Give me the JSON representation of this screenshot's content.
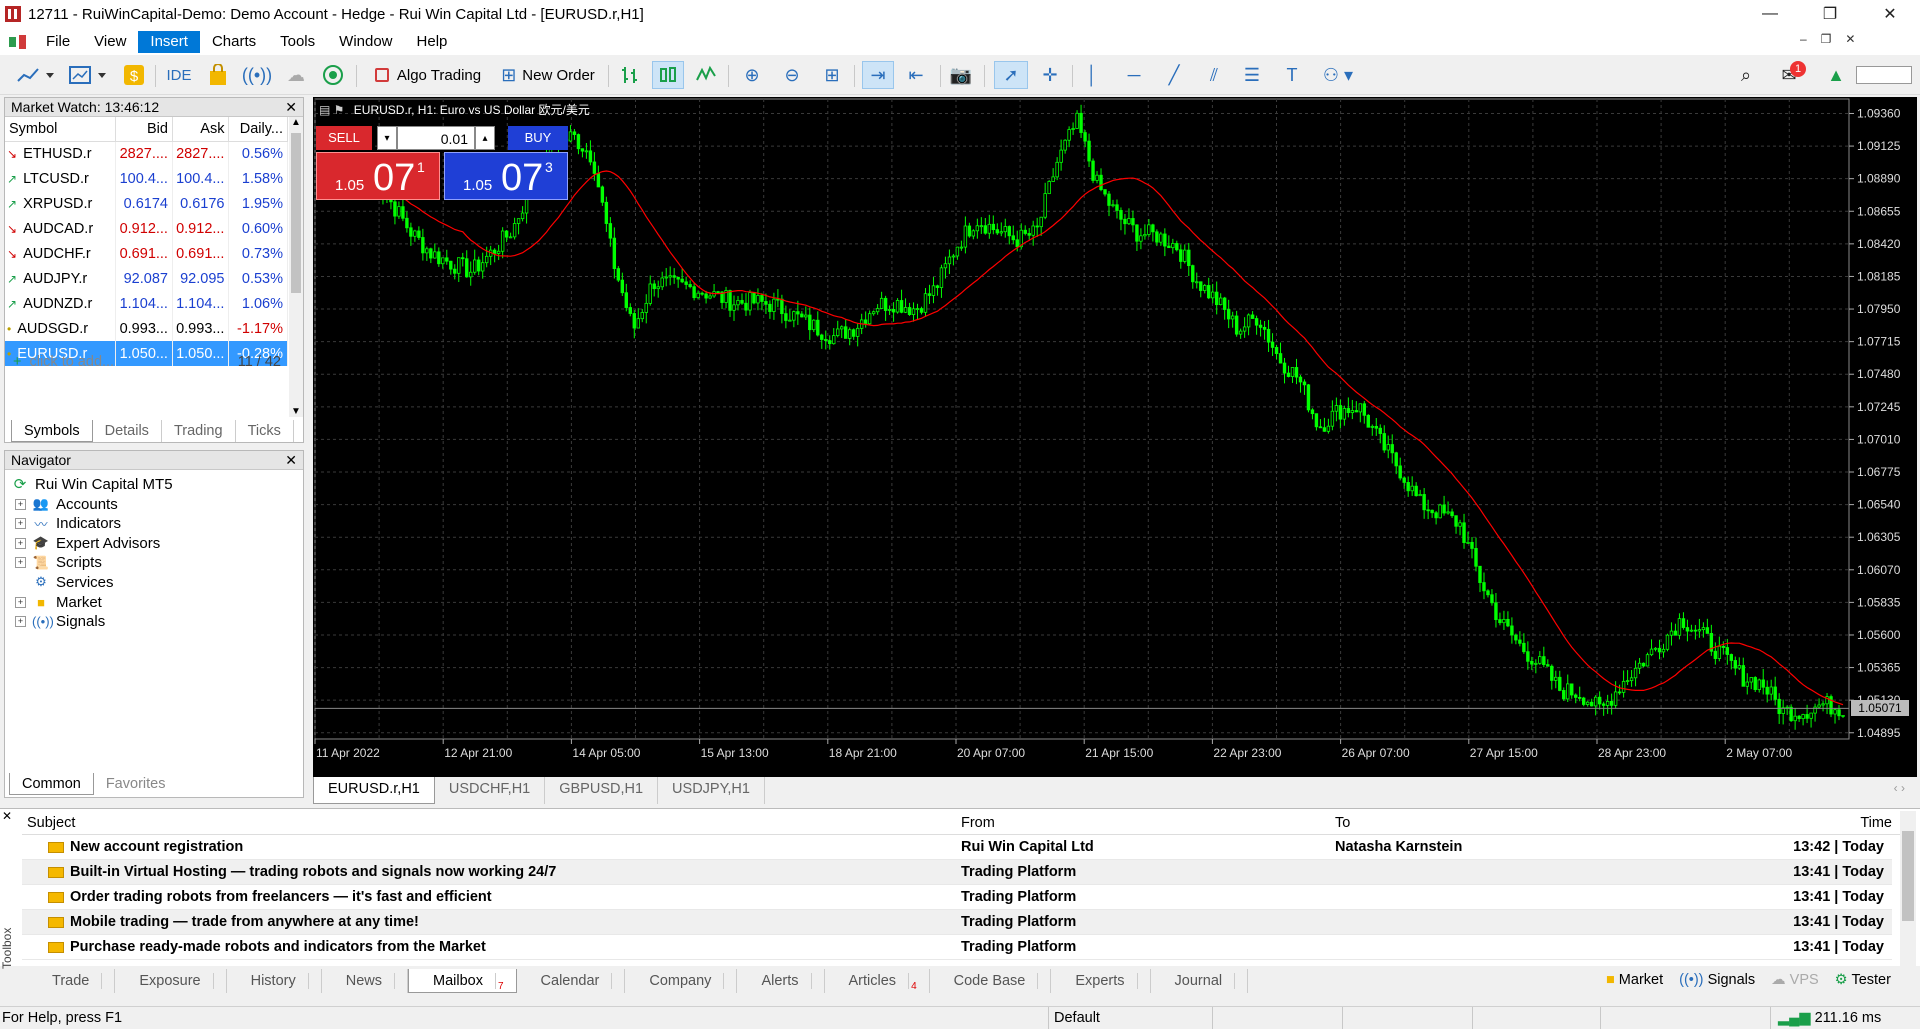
{
  "window": {
    "title": "12711 - RuiWinCapital-Demo: Demo Account - Hedge - Rui Win Capital Ltd - [EURUSD.r,H1]",
    "minimize": "—",
    "maximize": "❐",
    "close": "✕"
  },
  "menu": [
    "File",
    "View",
    "Insert",
    "Charts",
    "Tools",
    "Window",
    "Help"
  ],
  "menu_active": "Insert",
  "toolbar": {
    "ide_label": "IDE",
    "algo_trading_label": "Algo Trading",
    "new_order_label": "New Order",
    "notification_count": "1"
  },
  "market_watch": {
    "title": "Market Watch: 13:46:12",
    "columns": [
      "Symbol",
      "Bid",
      "Ask",
      "Daily..."
    ],
    "rows": [
      {
        "symbol": "ETHUSD.r",
        "bid": "2827....",
        "ask": "2827....",
        "daily": "0.56%",
        "dir": "down",
        "color": "red"
      },
      {
        "symbol": "LTCUSD.r",
        "bid": "100.4...",
        "ask": "100.4...",
        "daily": "1.58%",
        "dir": "up",
        "color": "blue"
      },
      {
        "symbol": "XRPUSD.r",
        "bid": "0.6174",
        "ask": "0.6176",
        "daily": "1.95%",
        "dir": "up",
        "color": "blue"
      },
      {
        "symbol": "AUDCAD.r",
        "bid": "0.912...",
        "ask": "0.912...",
        "daily": "0.60%",
        "dir": "down",
        "color": "red"
      },
      {
        "symbol": "AUDCHF.r",
        "bid": "0.691...",
        "ask": "0.691...",
        "daily": "0.73%",
        "dir": "down",
        "color": "red"
      },
      {
        "symbol": "AUDJPY.r",
        "bid": "92.087",
        "ask": "92.095",
        "daily": "0.53%",
        "dir": "up",
        "color": "blue"
      },
      {
        "symbol": "AUDNZD.r",
        "bid": "1.104...",
        "ask": "1.104...",
        "daily": "1.06%",
        "dir": "up",
        "color": "blue"
      },
      {
        "symbol": "AUDSGD.r",
        "bid": "0.993...",
        "ask": "0.993...",
        "daily": "-1.17%",
        "dir": "dot",
        "color": "black"
      },
      {
        "symbol": "EURUSD.r",
        "bid": "1.050...",
        "ask": "1.050...",
        "daily": "-0.28%",
        "dir": "dot",
        "color": "black",
        "selected": true
      }
    ],
    "add_placeholder": "click to add...",
    "count": "11 / 42",
    "tabs": [
      "Symbols",
      "Details",
      "Trading",
      "Ticks"
    ],
    "active_tab": "Symbols"
  },
  "navigator": {
    "title": "Navigator",
    "root": "Rui Win Capital MT5",
    "items": [
      "Accounts",
      "Indicators",
      "Expert Advisors",
      "Scripts",
      "Services",
      "Market",
      "Signals"
    ],
    "tabs": [
      "Common",
      "Favorites"
    ],
    "active_tab": "Common"
  },
  "chart": {
    "header": "EURUSD.r, H1:  Euro vs US Dollar 欧元/美元",
    "sell_label": "SELL",
    "buy_label": "BUY",
    "lot": "0.01",
    "sell_price_small": "1.05",
    "sell_price_big": "07",
    "sell_price_sup": "1",
    "buy_price_small": "1.05",
    "buy_price_big": "07",
    "buy_price_sup": "3",
    "current_price_label": "1.05071",
    "colors": {
      "bg": "#000000",
      "candle": "#00ff00",
      "ma": "#ff0000",
      "grid": "#3a3a3a"
    },
    "price_ticks": [
      "1.09360",
      "1.09125",
      "1.08890",
      "1.08655",
      "1.08420",
      "1.08185",
      "1.07950",
      "1.07715",
      "1.07480",
      "1.07245",
      "1.07010",
      "1.06775",
      "1.06540",
      "1.06305",
      "1.06070",
      "1.05835",
      "1.05600",
      "1.05365",
      "1.05130",
      "1.04895"
    ],
    "time_ticks": [
      "11 Apr 2022",
      "12 Apr 21:00",
      "14 Apr 05:00",
      "15 Apr 13:00",
      "18 Apr 21:00",
      "20 Apr 07:00",
      "21 Apr 15:00",
      "22 Apr 23:00",
      "26 Apr 07:00",
      "27 Apr 15:00",
      "28 Apr 23:00",
      "2 May 07:00"
    ]
  },
  "chart_data": {
    "type": "candlestick",
    "symbol": "EURUSD.r",
    "timeframe": "H1",
    "price_path": [
      1.0893,
      1.0872,
      1.085,
      1.0835,
      1.0828,
      1.0822,
      1.0836,
      1.0852,
      1.0885,
      1.0912,
      1.092,
      1.0905,
      1.083,
      1.078,
      1.0815,
      1.0812,
      1.081,
      1.0805,
      1.08,
      1.08,
      1.0798,
      1.079,
      1.0782,
      1.0775,
      1.0782,
      1.0798,
      1.08,
      1.0795,
      1.081,
      1.084,
      1.086,
      1.0852,
      1.0845,
      1.085,
      1.09,
      1.093,
      1.0885,
      1.0862,
      1.085,
      1.0848,
      1.084,
      1.0815,
      1.08,
      1.078,
      1.079,
      1.076,
      1.0745,
      1.071,
      1.0722,
      1.0725,
      1.07,
      1.068,
      1.0655,
      1.0648,
      1.064,
      1.06,
      1.057,
      1.0552,
      1.0538,
      1.052,
      1.0518,
      1.0505,
      1.0525,
      1.054,
      1.0555,
      1.0572,
      1.056,
      1.0545,
      1.053,
      1.0525,
      1.0505,
      1.0505,
      1.051,
      1.0507
    ],
    "ylim": [
      1.0485,
      1.0945
    ]
  },
  "chart_tabs": [
    "EURUSD.r,H1",
    "USDCHF,H1",
    "GBPUSD,H1",
    "USDJPY,H1"
  ],
  "active_chart_tab": "EURUSD.r,H1",
  "mailbox": {
    "columns": [
      "Subject",
      "From",
      "To",
      "Time"
    ],
    "rows": [
      {
        "subject": "New account registration",
        "from": "Rui Win Capital Ltd",
        "to": "Natasha Karnstein",
        "time": "13:42 | Today"
      },
      {
        "subject": "Built-in Virtual Hosting — trading robots and signals now working 24/7",
        "from": "Trading Platform",
        "to": "",
        "time": "13:41 | Today"
      },
      {
        "subject": "Order trading robots from freelancers — it's fast and efficient",
        "from": "Trading Platform",
        "to": "",
        "time": "13:41 | Today"
      },
      {
        "subject": "Mobile trading — trade from anywhere at any time!",
        "from": "Trading Platform",
        "to": "",
        "time": "13:41 | Today"
      },
      {
        "subject": "Purchase ready-made robots and indicators from the Market",
        "from": "Trading Platform",
        "to": "",
        "time": "13:41 | Today"
      }
    ]
  },
  "toolbox_label": "Toolbox",
  "bottom_tabs": [
    {
      "label": "Trade"
    },
    {
      "label": "Exposure"
    },
    {
      "label": "History"
    },
    {
      "label": "News"
    },
    {
      "label": "Mailbox",
      "badge": "7",
      "active": true
    },
    {
      "label": "Calendar"
    },
    {
      "label": "Company"
    },
    {
      "label": "Alerts"
    },
    {
      "label": "Articles",
      "badge": "4"
    },
    {
      "label": "Code Base"
    },
    {
      "label": "Experts"
    },
    {
      "label": "Journal"
    }
  ],
  "bottom_right": [
    "Market",
    "Signals",
    "VPS",
    "Tester"
  ],
  "status": {
    "help": "For Help, press F1",
    "profile": "Default",
    "ping": "211.16 ms"
  }
}
